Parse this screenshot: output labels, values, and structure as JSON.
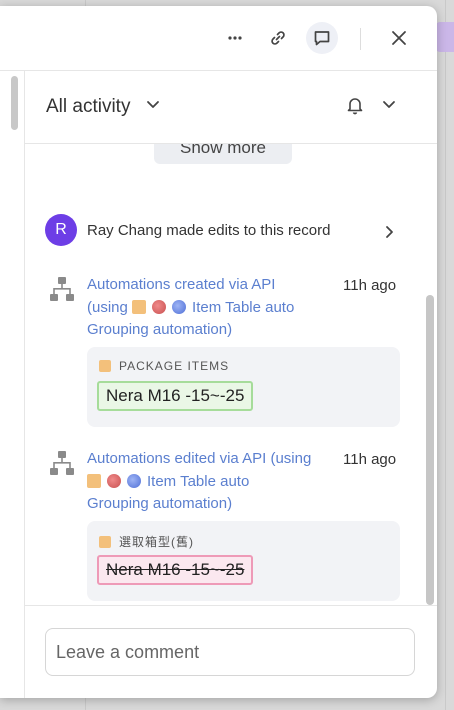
{
  "topbar": {
    "icons": [
      "more-horizontal-icon",
      "link-icon",
      "comment-icon",
      "close-icon"
    ]
  },
  "filter": {
    "label": "All activity",
    "icons": [
      "chevron-down-icon",
      "bell-icon"
    ]
  },
  "feed": {
    "show_more_label": "Show more",
    "record_edit": {
      "avatar_initial": "R",
      "text": "Ray Chang made edits to this record"
    },
    "activities": [
      {
        "line1": "Automations created via API",
        "line2": "(using",
        "line2b": "Item Table auto",
        "line3": "Grouping automation)",
        "time": "11h ago",
        "field": "PACKAGE ITEMS",
        "value": "Nera M16 -15~-25",
        "change": "added"
      },
      {
        "line1": "Automations edited via API (using",
        "line2b": "Item Table auto",
        "line3": "Grouping automation)",
        "time": "11h ago",
        "field": "選取箱型(舊)",
        "value": "Nera M16 -15~-25",
        "change": "removed"
      }
    ]
  },
  "comment": {
    "placeholder": "Leave a comment"
  },
  "colors": {
    "link": "#5b7fcf",
    "avatar": "#6d3ee6",
    "added_border": "#a6dc9a",
    "removed_border": "#ee9ab7",
    "field_icon": "#f3c07b"
  }
}
